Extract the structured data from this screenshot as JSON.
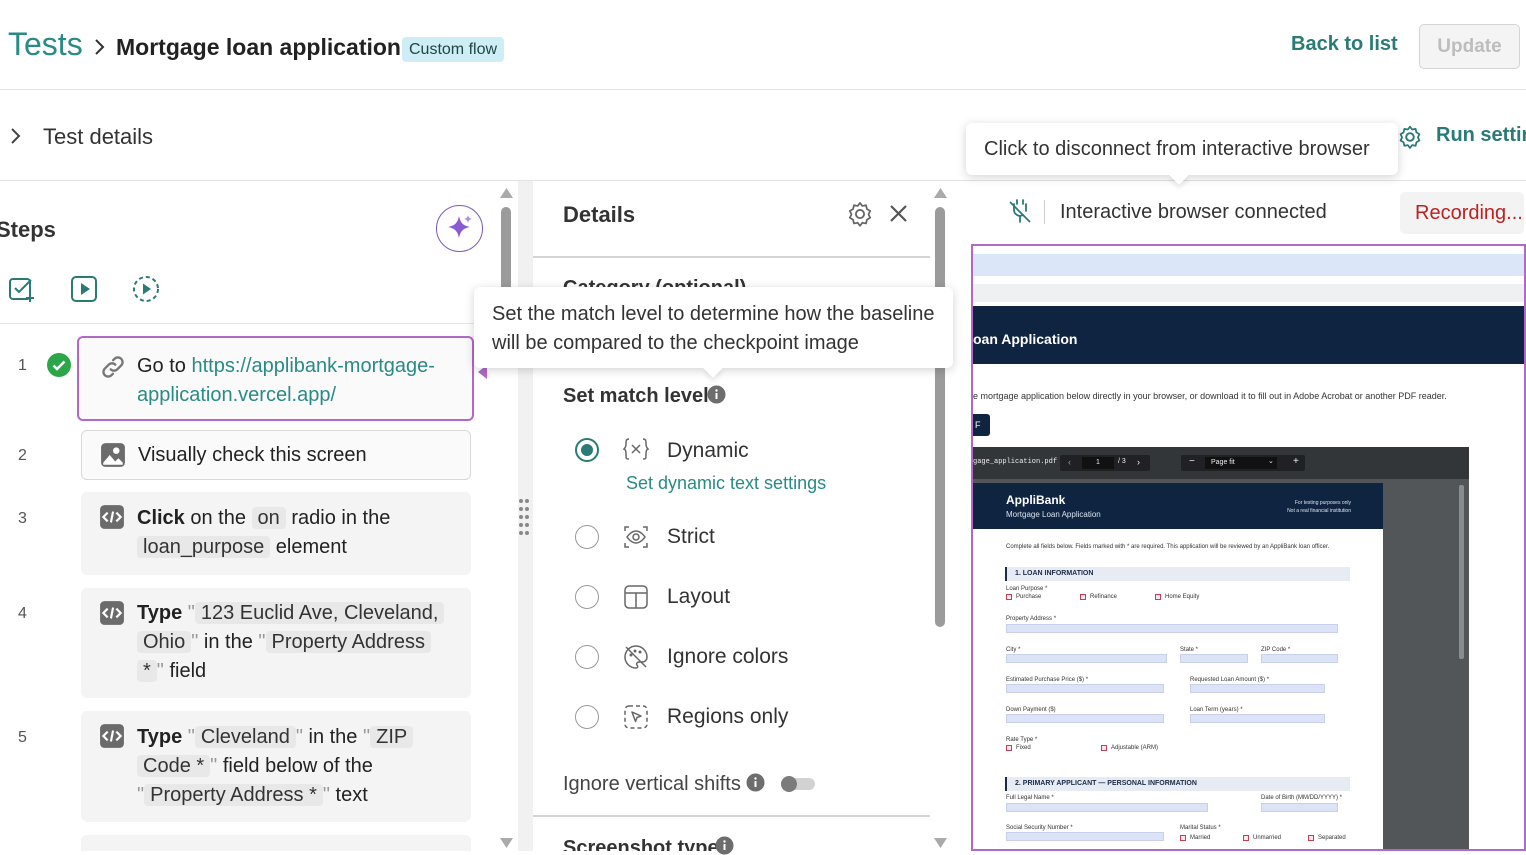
{
  "header": {
    "breadcrumb_root": "Tests",
    "title": "Mortgage loan application",
    "badge": "Custom flow",
    "back_label": "Back to list",
    "update_label": "Update"
  },
  "details_row": {
    "label": "Test details",
    "run_settings_label": "Run settin"
  },
  "tooltips": {
    "disconnect": "Click to disconnect from interactive browser",
    "match_level_line1": "Set the match level to determine how the baseline",
    "match_level_line2": "will be compared to the checkpoint image"
  },
  "steps": {
    "title": "Steps",
    "items": [
      {
        "num": "1",
        "prefix": "Go to ",
        "link_line1": "https://applibank-mortgage-",
        "link_line2": "application.vercel.app/"
      },
      {
        "num": "2",
        "text": "Visually check this screen"
      },
      {
        "num": "3",
        "w1": "Click",
        "w2": "on the",
        "chip1": "on",
        "w3": "radio in the",
        "chip2": "loan_purpose",
        "w4": "element"
      },
      {
        "num": "4",
        "w1": "Type",
        "chip1a": "123 Euclid Ave, Cleveland,",
        "chip1b": "Ohio",
        "w2": "in the",
        "chip2a": "Property Address",
        "chip2b": "*",
        "w3": "field"
      },
      {
        "num": "5",
        "w1": "Type",
        "chip1": "Cleveland",
        "w2": "in the",
        "chip2a": "ZIP",
        "chip2b": "Code *",
        "w3": "field below of the",
        "chip3": "Property Address *",
        "w4": "text"
      }
    ],
    "quote": "\""
  },
  "details": {
    "title": "Details",
    "category_label": "Category (optional)",
    "match_level_label": "Set match level",
    "options": [
      {
        "label": "Dynamic",
        "selected": true,
        "icon": "variable-icon"
      },
      {
        "label": "Strict",
        "selected": false,
        "icon": "eye-icon"
      },
      {
        "label": "Layout",
        "selected": false,
        "icon": "layout-icon"
      },
      {
        "label": "Ignore colors",
        "selected": false,
        "icon": "palette-off-icon"
      },
      {
        "label": "Regions only",
        "selected": false,
        "icon": "region-cursor-icon"
      }
    ],
    "dynamic_link": "Set dynamic text settings",
    "ignore_vertical_label": "Ignore vertical shifts",
    "ignore_vertical_on": false,
    "screenshot_type_label": "Screenshot type"
  },
  "browser": {
    "status": "Interactive browser connected",
    "recording": "Recording...",
    "site": {
      "heading": "oan Application",
      "intro": "e mortgage application below directly in your browser, or download it to fill out in Adobe Acrobat or another PDF reader.",
      "btn": "F",
      "pdf_file": "gage_application.pdf",
      "page": "1",
      "page_total": "/ 3",
      "zoom": "Page fit",
      "brand": "AppliBank",
      "doc_title": "Mortgage Loan Application",
      "disclaimer1": "For testing purposes only",
      "disclaimer2": "Not a real financial institution",
      "instructions": "Complete all fields below. Fields marked with * are required. This application will be reviewed by an AppliBank loan officer.",
      "sec1": "1. LOAN INFORMATION",
      "loan_purpose": "Loan Purpose *",
      "purchase": "Purchase",
      "refinance": "Refinance",
      "home_equity": "Home Equity",
      "property_address": "Property Address *",
      "city": "City *",
      "state": "State *",
      "zip": "ZIP Code *",
      "est_price": "Estimated Purchase Price ($) *",
      "loan_amount": "Requested Loan Amount ($) *",
      "down_payment": "Down Payment ($)",
      "loan_term": "Loan Term (years) *",
      "rate_type": "Rate Type *",
      "fixed": "Fixed",
      "adjustable": "Adjustable (ARM)",
      "sec2": "2. PRIMARY APPLICANT — PERSONAL INFORMATION",
      "full_name": "Full Legal Name *",
      "dob": "Date of Birth (MM/DD/YYYY) *",
      "ssn": "Social Security Number *",
      "marital": "Marital Status *",
      "married": "Married",
      "unmarried": "Unmarried",
      "separated": "Separated"
    }
  },
  "colors": {
    "accent": "#2a8a85",
    "highlight": "#b268c8",
    "navy": "#0f2440",
    "recording": "#b22222"
  }
}
